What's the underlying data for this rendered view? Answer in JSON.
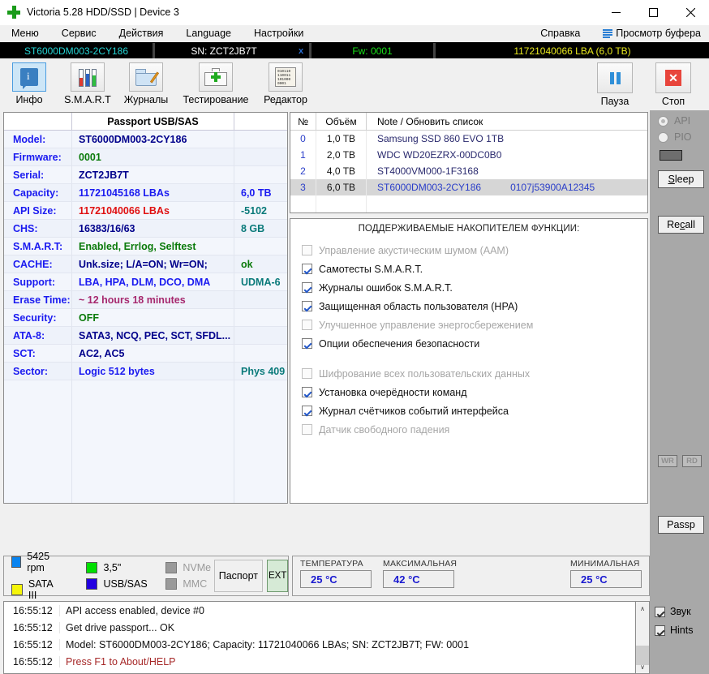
{
  "window": {
    "title": "Victoria 5.28 HDD/SSD | Device 3",
    "app_icon": "green-cross-icon",
    "minimize": "—",
    "maximize": "□",
    "close": "✕"
  },
  "menubar": {
    "items": [
      {
        "label": "Меню"
      },
      {
        "label": "Сервис"
      },
      {
        "label": "Действия"
      },
      {
        "label": "Language"
      },
      {
        "label": "Настройки"
      }
    ],
    "help": "Справка",
    "buffer_view": "Просмотр буфера",
    "buffer_icon": "list-lines-icon"
  },
  "device_bar": {
    "model": "ST6000DM003-2CY186",
    "serial": "SN: ZCT2JB7T",
    "close_mark": "x",
    "firmware": "Fw: 0001",
    "lba": "11721040066 LBA (6,0 TB)",
    "colors": {
      "model": "#26d6d6",
      "serial": "#ffffff",
      "firmware": "#19e219",
      "lba": "#e8e81e",
      "background": "#000000"
    }
  },
  "toolbar": {
    "buttons": [
      {
        "label": "Инфо",
        "icon": "info-icon",
        "selected": true
      },
      {
        "label": "S.M.A.R.T",
        "icon": "test-tubes-icon",
        "selected": false
      },
      {
        "label": "Журналы",
        "icon": "folder-pencil-icon",
        "selected": false
      },
      {
        "label": "Тестирование",
        "icon": "medical-case-icon",
        "selected": false
      },
      {
        "label": "Редактор",
        "icon": "binary-paper-icon",
        "selected": false
      }
    ],
    "right_buttons": [
      {
        "label": "Пауза",
        "icon": "pause-icon"
      },
      {
        "label": "Стоп",
        "icon": "stop-icon"
      }
    ],
    "editor_icon_lines": [
      "010110",
      "110011",
      "101000",
      "0001"
    ]
  },
  "passport": {
    "header": {
      "col1": "",
      "col2": "Passport USB/SAS",
      "col3": ""
    },
    "rows": [
      {
        "label": "Model:",
        "value": "ST6000DM003-2CY186",
        "extra": "",
        "value_color": "#00008b",
        "extra_color": ""
      },
      {
        "label": "Firmware:",
        "value": "0001",
        "extra": "",
        "value_color": "#0a7a0a",
        "extra_color": ""
      },
      {
        "label": "Serial:",
        "value": "ZCT2JB7T",
        "extra": "",
        "value_color": "#00008b",
        "extra_color": ""
      },
      {
        "label": "Capacity:",
        "value": "11721045168 LBAs",
        "extra": "6,0 TB",
        "value_color": "#1a1af0",
        "extra_color": "#1a1af0"
      },
      {
        "label": "API Size:",
        "value": "11721040066 LBAs",
        "extra": "-5102",
        "value_color": "#e01010",
        "extra_color": "#0a7a7a"
      },
      {
        "label": "CHS:",
        "value": "16383/16/63",
        "extra": "8 GB",
        "value_color": "#00008b",
        "extra_color": "#0a7a7a"
      },
      {
        "label": "S.M.A.R.T:",
        "value": "Enabled, Errlog, Selftest",
        "extra": "",
        "value_color": "#0a7a0a",
        "extra_color": ""
      },
      {
        "label": "CACHE:",
        "value": "Unk.size; L/A=ON; Wr=ON;",
        "extra": "ok",
        "value_color": "#00008b",
        "extra_color": "#0a7a0a"
      },
      {
        "label": "Support:",
        "value": "LBA, HPA, DLM, DCO, DMA",
        "extra": "UDMA-6",
        "value_color": "#1a1af0",
        "extra_color": "#0a7a7a"
      },
      {
        "label": "Erase Time:",
        "value": "~ 12 hours 18 minutes",
        "extra": "",
        "value_color": "#a6286e",
        "extra_color": ""
      },
      {
        "label": "Security:",
        "value": "OFF",
        "extra": "",
        "value_color": "#0a7a0a",
        "extra_color": ""
      },
      {
        "label": "ATA-8:",
        "value": "SATA3, NCQ, PEC, SCT, SFDL...",
        "extra": "",
        "value_color": "#00008b",
        "extra_color": ""
      },
      {
        "label": "SCT:",
        "value": "AC2, AC5",
        "extra": "",
        "value_color": "#00008b",
        "extra_color": ""
      },
      {
        "label": "Sector:",
        "value": "Logic 512 bytes",
        "extra": "Phys 409",
        "value_color": "#1a1af0",
        "extra_color": "#0a7a7a"
      }
    ],
    "label_color": "#1a1af0"
  },
  "device_list": {
    "headers": [
      "№",
      "Объём",
      "Note / Обновить список"
    ],
    "rows": [
      {
        "num": "0",
        "size": "1,0 TB",
        "note": "Samsung SSD 860 EVO 1TB",
        "note_sn": "",
        "selected": false
      },
      {
        "num": "1",
        "size": "2,0 TB",
        "note": "WDC WD20EZRX-00DC0B0",
        "note_sn": "",
        "selected": false
      },
      {
        "num": "2",
        "size": "4,0 TB",
        "note": "ST4000VM000-1F3168",
        "note_sn": "",
        "selected": false
      },
      {
        "num": "3",
        "size": "6,0 TB",
        "note": "ST6000DM003-2CY186",
        "note_sn": "0107j53900A12345",
        "selected": true
      }
    ]
  },
  "features": {
    "title": "ПОДДЕРЖИВАЕМЫЕ НАКОПИТЕЛЕМ ФУНКЦИИ:",
    "items": [
      {
        "label": "Управление акустическим шумом (AAM)",
        "checked": false,
        "enabled": false
      },
      {
        "label": "Самотесты S.M.A.R.T.",
        "checked": true,
        "enabled": true
      },
      {
        "label": "Журналы ошибок S.M.A.R.T.",
        "checked": true,
        "enabled": true
      },
      {
        "label": "Защищенная область пользователя (HPA)",
        "checked": true,
        "enabled": true
      },
      {
        "label": "Улучшенное управление энергосбережением",
        "checked": false,
        "enabled": false
      },
      {
        "label": "Опции обеспечения безопасности",
        "checked": true,
        "enabled": true
      },
      {
        "label": "Шифрование всех пользовательских данных",
        "checked": false,
        "enabled": false
      },
      {
        "label": "Установка очерёдности команд",
        "checked": true,
        "enabled": true
      },
      {
        "label": "Журнал счётчиков событий интерфейса",
        "checked": true,
        "enabled": true
      },
      {
        "label": "Датчик свободного падения",
        "checked": false,
        "enabled": false
      }
    ]
  },
  "sidebar": {
    "radios": [
      {
        "label": "API",
        "selected": true
      },
      {
        "label": "PIO",
        "selected": false
      }
    ],
    "swatch": "#6e6e6e",
    "buttons": [
      {
        "label": "Sleep",
        "accel_index": 0
      },
      {
        "label": "Recall",
        "accel_index": 2
      }
    ],
    "mini_buttons": [
      {
        "label": "WR"
      },
      {
        "label": "RD"
      }
    ],
    "passp_button": "Passp"
  },
  "legend": {
    "items": [
      {
        "label": "5425 rpm",
        "color": "#0a84f0",
        "enabled": true
      },
      {
        "label": "SATA III",
        "color": "#f5f50a",
        "enabled": true
      },
      {
        "label": "3,5\"",
        "color": "#00e000",
        "enabled": true
      },
      {
        "label": "USB/SAS",
        "color": "#2200e0",
        "enabled": true
      },
      {
        "label": "NVMe",
        "color": "#9a9a9a",
        "enabled": false
      },
      {
        "label": "MMC",
        "color": "#9a9a9a",
        "enabled": false
      }
    ],
    "passport_button": "Паспорт",
    "ext_button": "EXT"
  },
  "temperature": {
    "current": {
      "label": "ТЕМПЕРАТУРА",
      "value": "25 °C"
    },
    "maximum": {
      "label": "МАКСИМАЛЬНАЯ",
      "value": "42 °C"
    },
    "minimum": {
      "label": "МИНИМАЛЬНАЯ",
      "value": "25 °C"
    }
  },
  "log": {
    "rows": [
      {
        "time": "16:55:12",
        "msg": "API access enabled, device #0",
        "warn": false
      },
      {
        "time": "16:55:12",
        "msg": "Get drive passport... OK",
        "warn": false
      },
      {
        "time": "16:55:12",
        "msg": "Model: ST6000DM003-2CY186; Capacity: 11721040066 LBAs; SN: ZCT2JB7T; FW: 0001",
        "warn": false
      },
      {
        "time": "16:55:12",
        "msg": "Press F1 to About/HELP",
        "warn": true
      }
    ],
    "scroll_up": "∧",
    "scroll_down": "∨"
  },
  "log_options": [
    {
      "label": "Звук",
      "checked": true
    },
    {
      "label": "Hints",
      "checked": true
    }
  ]
}
